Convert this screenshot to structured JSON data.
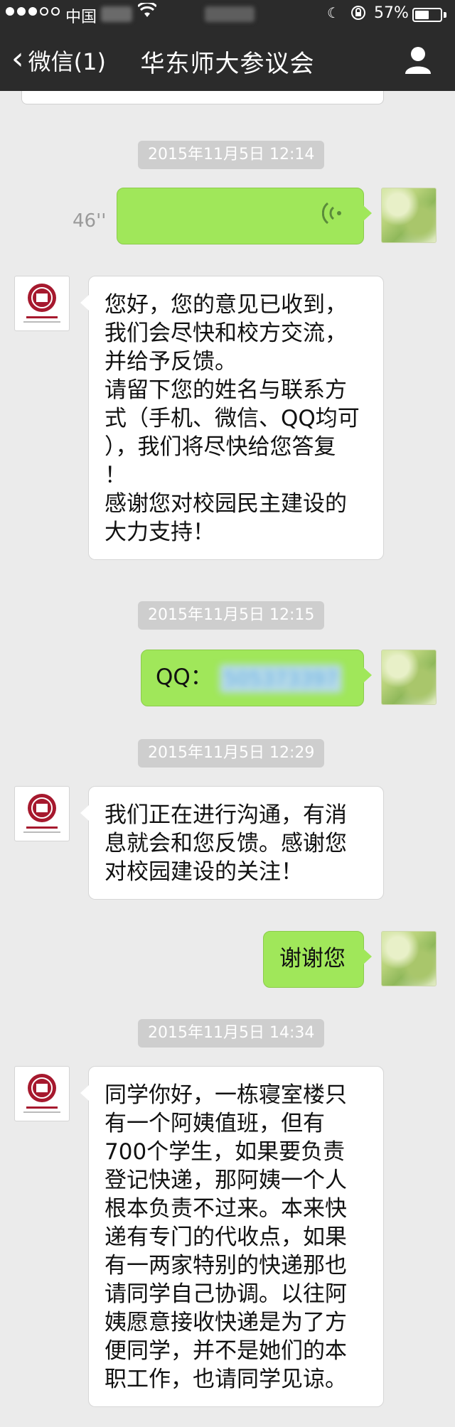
{
  "status_bar": {
    "carrier": "中国",
    "battery_percent": "57%",
    "battery_level": 0.57,
    "icons": [
      "signal-dots",
      "wifi-icon",
      "moon-icon",
      "orientation-lock-icon",
      "battery-icon"
    ]
  },
  "nav": {
    "back_label": "微信(1)",
    "title": "华东师大参议会",
    "profile_icon": "person-icon"
  },
  "colors": {
    "navbar": "#2b2b2b",
    "chat_background": "#ebebeb",
    "outgoing_bubble": "#a0e75a",
    "incoming_bubble": "#ffffff",
    "timestamp_pill": "#cecece"
  },
  "messages": [
    {
      "kind": "timestamp",
      "text": "2015年11月5日 12:14"
    },
    {
      "kind": "voice",
      "side": "out",
      "duration": "46''"
    },
    {
      "kind": "text",
      "side": "in",
      "lines": [
        "您好，您的意见已收到，",
        "我们会尽快和校方交流，",
        "并给予反馈。",
        "请留下您的姓名与联系方",
        "式（手机、微信、QQ均可",
        "），我们将尽快给您答复",
        "！",
        "感谢您对校园民主建设的",
        "大力支持！"
      ]
    },
    {
      "kind": "timestamp",
      "text": "2015年11月5日 12:15"
    },
    {
      "kind": "text",
      "side": "out",
      "prefix": "QQ：",
      "redacted": "505373397"
    },
    {
      "kind": "timestamp",
      "text": "2015年11月5日 12:29"
    },
    {
      "kind": "text",
      "side": "in",
      "lines": [
        "我们正在进行沟通，有消",
        "息就会和您反馈。感谢您",
        "对校园建设的关注！"
      ]
    },
    {
      "kind": "text",
      "side": "out",
      "lines": [
        "谢谢您"
      ]
    },
    {
      "kind": "timestamp",
      "text": "2015年11月5日 14:34"
    },
    {
      "kind": "text",
      "side": "in",
      "lines": [
        "同学你好，一栋寝室楼只",
        "有一个阿姨值班，但有",
        "700个学生，如果要负责",
        "登记快递，那阿姨一个人",
        "根本负责不过来。本来快",
        "递有专门的代收点，如果",
        "有一两家特别的快递那也",
        "请同学自己协调。以往阿",
        "姨愿意接收快递是为了方",
        "便同学，并不是她们的本",
        "职工作，也请同学见谅。"
      ]
    }
  ]
}
